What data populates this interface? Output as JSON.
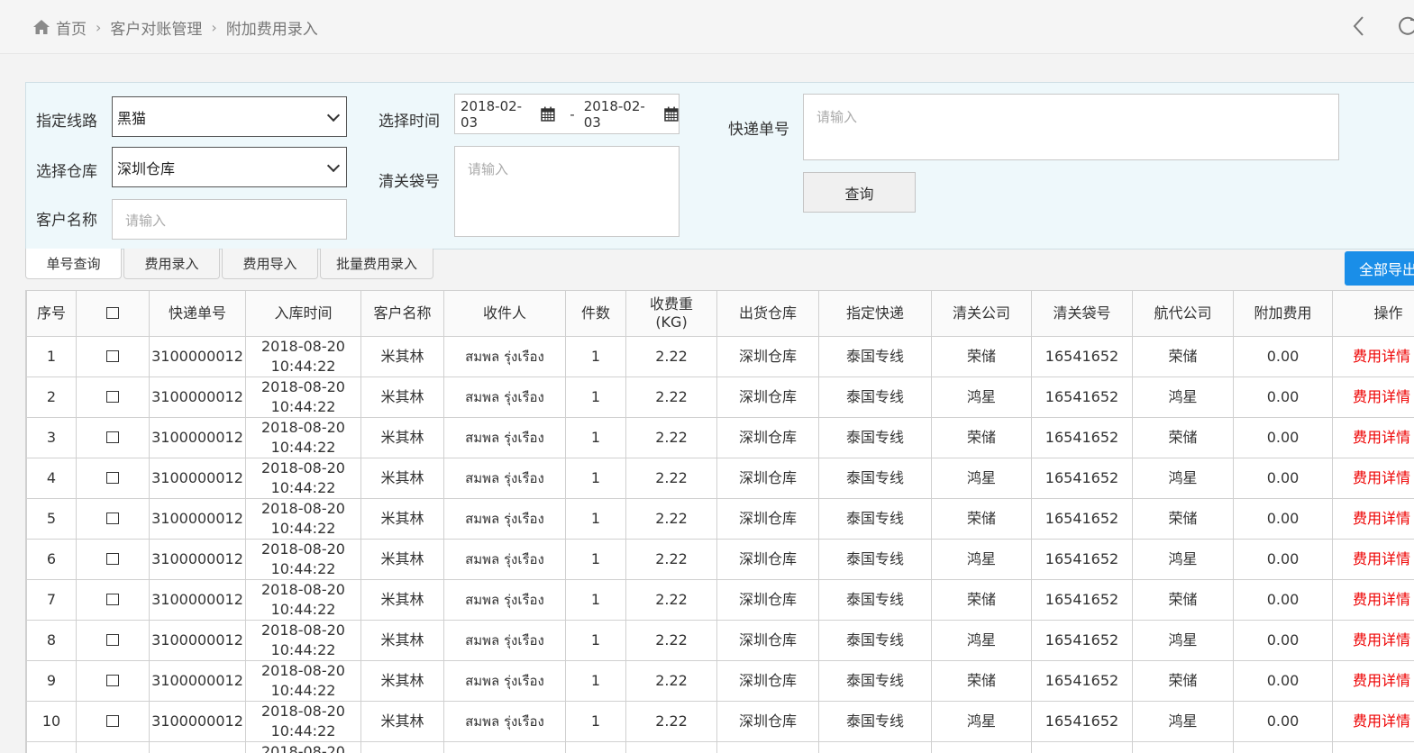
{
  "breadcrumb": {
    "home": "首页",
    "level1": "客户对账管理",
    "level2": "附加费用录入"
  },
  "filters": {
    "route_label": "指定线路",
    "route_value": "黑猫",
    "warehouse_label": "选择仓库",
    "warehouse_value": "深圳仓库",
    "customer_label": "客户名称",
    "customer_placeholder": "请输入",
    "time_label": "选择时间",
    "date_start": "2018-02-03",
    "date_sep": "-",
    "date_end": "2018-02-03",
    "bag_label": "清关袋号",
    "bag_placeholder": "请输入",
    "express_label": "快递单号",
    "express_placeholder": "请输入",
    "query_button": "查询"
  },
  "tabs": [
    "单号查询",
    "费用录入",
    "费用导入",
    "批量费用录入"
  ],
  "export_button": "全部导出",
  "table": {
    "headers": [
      "序号",
      "口",
      "快递单号",
      "入库时间",
      "客户名称",
      "收件人",
      "件数",
      "收费重\n(KG)",
      "出货仓库",
      "指定快递",
      "清关公司",
      "清关袋号",
      "航代公司",
      "附加费用",
      "操作"
    ],
    "rows": [
      [
        "1",
        "口",
        "3100000012",
        "2018-08-20",
        "10:44:22",
        "米其林",
        "สมพล รุ่งเรือง",
        "1",
        "2.22",
        "深圳仓库",
        "泰国专线",
        "荣储",
        "16541652",
        "荣储",
        "0.00",
        "费用详情"
      ],
      [
        "2",
        "口",
        "3100000012",
        "2018-08-20",
        "10:44:22",
        "米其林",
        "สมพล รุ่งเรือง",
        "1",
        "2.22",
        "深圳仓库",
        "泰国专线",
        "鸿星",
        "16541652",
        "鸿星",
        "0.00",
        "费用详情"
      ],
      [
        "3",
        "口",
        "3100000012",
        "2018-08-20",
        "10:44:22",
        "米其林",
        "สมพล รุ่งเรือง",
        "1",
        "2.22",
        "深圳仓库",
        "泰国专线",
        "荣储",
        "16541652",
        "荣储",
        "0.00",
        "费用详情"
      ],
      [
        "4",
        "口",
        "3100000012",
        "2018-08-20",
        "10:44:22",
        "米其林",
        "สมพล รุ่งเรือง",
        "1",
        "2.22",
        "深圳仓库",
        "泰国专线",
        "鸿星",
        "16541652",
        "鸿星",
        "0.00",
        "费用详情"
      ],
      [
        "5",
        "口",
        "3100000012",
        "2018-08-20",
        "10:44:22",
        "米其林",
        "สมพล รุ่งเรือง",
        "1",
        "2.22",
        "深圳仓库",
        "泰国专线",
        "荣储",
        "16541652",
        "荣储",
        "0.00",
        "费用详情"
      ],
      [
        "6",
        "口",
        "3100000012",
        "2018-08-20",
        "10:44:22",
        "米其林",
        "สมพล รุ่งเรือง",
        "1",
        "2.22",
        "深圳仓库",
        "泰国专线",
        "鸿星",
        "16541652",
        "鸿星",
        "0.00",
        "费用详情"
      ],
      [
        "7",
        "口",
        "3100000012",
        "2018-08-20",
        "10:44:22",
        "米其林",
        "สมพล รุ่งเรือง",
        "1",
        "2.22",
        "深圳仓库",
        "泰国专线",
        "荣储",
        "16541652",
        "荣储",
        "0.00",
        "费用详情"
      ],
      [
        "8",
        "口",
        "3100000012",
        "2018-08-20",
        "10:44:22",
        "米其林",
        "สมพล รุ่งเรือง",
        "1",
        "2.22",
        "深圳仓库",
        "泰国专线",
        "鸿星",
        "16541652",
        "鸿星",
        "0.00",
        "费用详情"
      ],
      [
        "9",
        "口",
        "3100000012",
        "2018-08-20",
        "10:44:22",
        "米其林",
        "สมพล รุ่งเรือง",
        "1",
        "2.22",
        "深圳仓库",
        "泰国专线",
        "荣储",
        "16541652",
        "荣储",
        "0.00",
        "费用详情"
      ],
      [
        "10",
        "口",
        "3100000012",
        "2018-08-20",
        "10:44:22",
        "米其林",
        "สมพล รุ่งเรือง",
        "1",
        "2.22",
        "深圳仓库",
        "泰国专线",
        "鸿星",
        "16541652",
        "鸿星",
        "0.00",
        "费用详情"
      ]
    ],
    "partial_row_time": "2018-08-20"
  },
  "colors": {
    "accent": "#1a8ee8",
    "link_red": "#e00000",
    "panel_bg": "#eef8fb"
  }
}
